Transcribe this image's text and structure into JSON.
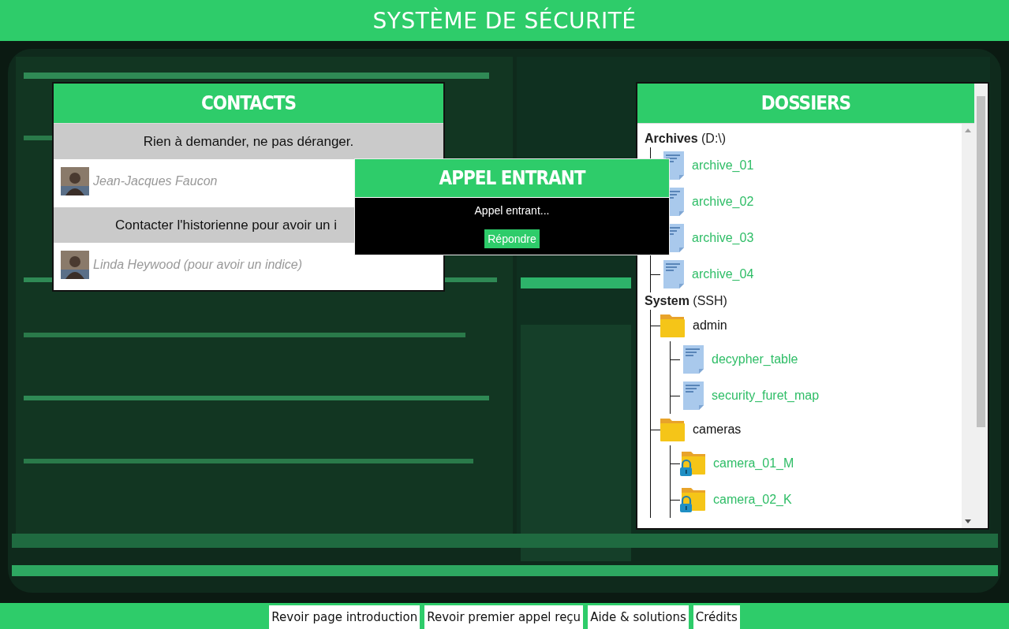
{
  "header": {
    "title": "SYSTÈME DE SÉCURITÉ"
  },
  "contacts": {
    "title": "CONTACTS",
    "rows": [
      {
        "kind": "message",
        "text": "Rien à demander, ne pas déranger."
      },
      {
        "kind": "contact",
        "name": "Jean-Jacques Faucon"
      },
      {
        "kind": "message",
        "text": "Contacter l'historienne pour avoir un i"
      },
      {
        "kind": "contact",
        "name": "Linda Heywood (pour avoir un indice)"
      }
    ]
  },
  "incoming_call": {
    "title": "APPEL ENTRANT",
    "message": "Appel entrant...",
    "button": "Répondre"
  },
  "dossiers": {
    "title": "DOSSIERS",
    "groups": [
      {
        "label": "**Archives** (D:\\)",
        "children": [
          {
            "kind": "file",
            "label": "archive_01"
          },
          {
            "kind": "file",
            "label": "archive_02"
          },
          {
            "kind": "file",
            "label": "archive_03"
          },
          {
            "kind": "file",
            "label": "archive_04"
          }
        ]
      },
      {
        "label": "**System** (SSH)",
        "children": [
          {
            "kind": "folder",
            "label": "admin",
            "children": [
              {
                "kind": "file",
                "label": "decypher_table"
              },
              {
                "kind": "file",
                "label": "security_furet_map"
              }
            ]
          },
          {
            "kind": "folder",
            "label": "cameras",
            "children": [
              {
                "kind": "locked-folder",
                "label": "camera_01_M"
              },
              {
                "kind": "locked-folder",
                "label": "camera_02_K"
              }
            ]
          }
        ]
      }
    ]
  },
  "footer": {
    "buttons": [
      "Revoir page introduction",
      "Revoir premier appel reçu",
      "Aide & solutions",
      "Crédits"
    ]
  }
}
